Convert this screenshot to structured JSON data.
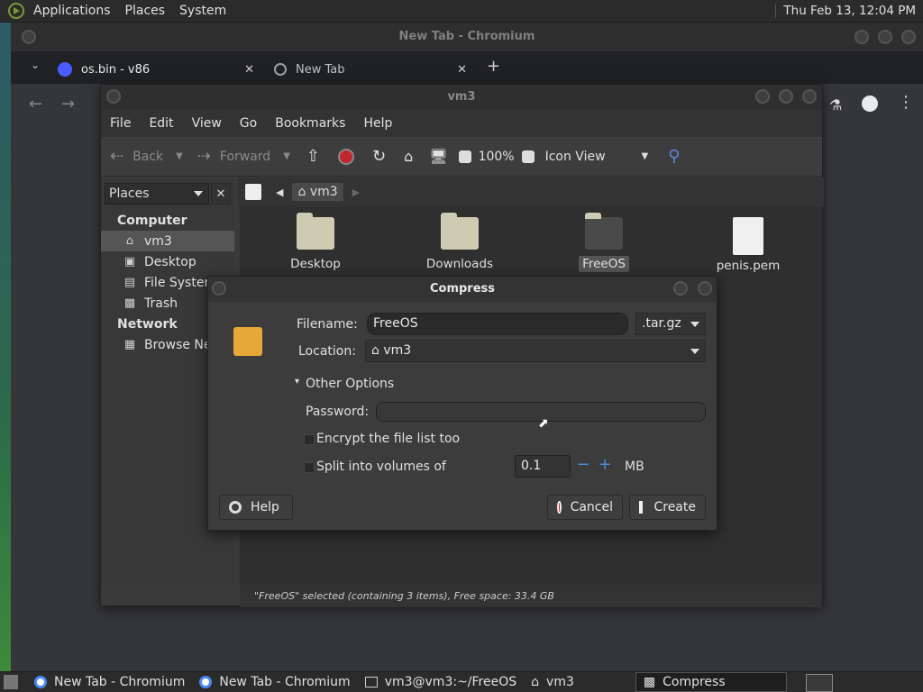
{
  "top_panel": {
    "menus": [
      "Applications",
      "Places",
      "System"
    ],
    "clock": "Thu Feb 13, 12:04 PM"
  },
  "chromium": {
    "title": "New Tab - Chromium",
    "tabs": [
      {
        "label": "os.bin - v86"
      },
      {
        "label": "New Tab"
      }
    ],
    "new_tab_symbol": "+"
  },
  "caja": {
    "title": "vm3",
    "menu": [
      "File",
      "Edit",
      "View",
      "Go",
      "Bookmarks",
      "Help"
    ],
    "toolbar": {
      "back": "Back",
      "forward": "Forward",
      "zoom": "100%",
      "view_mode": "Icon View"
    },
    "places_combo": "Places",
    "sidebar": {
      "computer_header": "Computer",
      "computer_items": [
        {
          "label": "vm3",
          "icon": "home-icon"
        },
        {
          "label": "Desktop",
          "icon": "desktop-icon"
        },
        {
          "label": "File System",
          "icon": "drive-icon"
        },
        {
          "label": "Trash",
          "icon": "trash-icon"
        }
      ],
      "network_header": "Network",
      "network_items": [
        {
          "label": "Browse Net",
          "icon": "network-icon"
        }
      ]
    },
    "pathbar": {
      "current": "vm3"
    },
    "files": [
      {
        "name": "Desktop",
        "type": "folder"
      },
      {
        "name": "Downloads",
        "type": "folder"
      },
      {
        "name": "FreeOS",
        "type": "folder"
      },
      {
        "name": "penis.pem",
        "type": "file"
      }
    ],
    "status": "\"FreeOS\" selected (containing 3 items), Free space: 33.4 GB"
  },
  "compress": {
    "title": "Compress",
    "filename_label": "Filename:",
    "filename_value": "FreeOS",
    "extension": ".tar.gz",
    "location_label": "Location:",
    "location_value": "vm3",
    "other_options": "Other Options",
    "password_label": "Password:",
    "password_value": "",
    "encrypt_label": "Encrypt the file list too",
    "split_label": "Split into volumes of",
    "split_value": "0.1",
    "split_unit": "MB",
    "help_button": "Help",
    "cancel_button": "Cancel",
    "create_button": "Create"
  },
  "taskbar": {
    "items": [
      {
        "label": "New Tab - Chromium"
      },
      {
        "label": "New Tab - Chromium"
      },
      {
        "label": "vm3@vm3:~/FreeOS"
      },
      {
        "label": "vm3"
      },
      {
        "label": "Compress"
      }
    ]
  }
}
